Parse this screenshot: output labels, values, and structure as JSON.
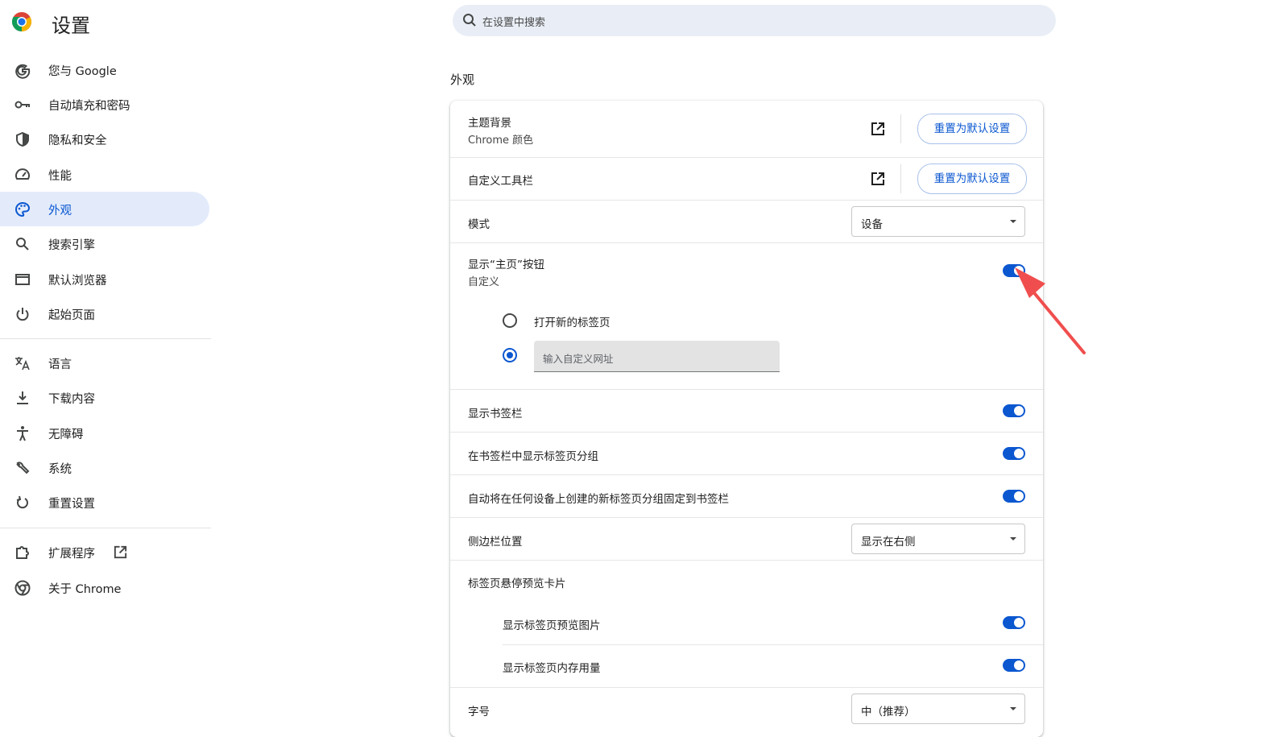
{
  "app": {
    "title": "设置"
  },
  "search": {
    "placeholder": "在设置中搜索"
  },
  "sidebar": {
    "items": [
      {
        "label": "您与 Google",
        "icon": "google-g-icon"
      },
      {
        "label": "自动填充和密码",
        "icon": "key-icon"
      },
      {
        "label": "隐私和安全",
        "icon": "shield-icon"
      },
      {
        "label": "性能",
        "icon": "speedometer-icon"
      },
      {
        "label": "外观",
        "icon": "palette-icon",
        "active": true
      },
      {
        "label": "搜索引擎",
        "icon": "search-icon"
      },
      {
        "label": "默认浏览器",
        "icon": "browser-window-icon"
      },
      {
        "label": "起始页面",
        "icon": "power-icon"
      },
      {
        "label": "语言",
        "icon": "translate-icon"
      },
      {
        "label": "下载内容",
        "icon": "download-icon"
      },
      {
        "label": "无障碍",
        "icon": "accessibility-icon"
      },
      {
        "label": "系统",
        "icon": "wrench-icon"
      },
      {
        "label": "重置设置",
        "icon": "reset-icon"
      },
      {
        "label": "扩展程序",
        "icon": "puzzle-icon"
      },
      {
        "label": "关于 Chrome",
        "icon": "chrome-icon"
      }
    ]
  },
  "appearance": {
    "section_title": "外观",
    "theme": {
      "title": "主题背景",
      "subtitle": "Chrome 颜色",
      "reset_label": "重置为默认设置"
    },
    "toolbar": {
      "title": "自定义工具栏",
      "reset_label": "重置为默认设置"
    },
    "mode": {
      "title": "模式",
      "value": "设备"
    },
    "home_button": {
      "title": "显示“主页”按钮",
      "subtitle": "自定义",
      "enabled": true,
      "option_new_tab": "打开新的标签页",
      "option_custom": "输入自定义网址",
      "selected": "custom"
    },
    "bookmarks_bar": {
      "title": "显示书签栏",
      "enabled": true
    },
    "tab_groups_in_bookmarks": {
      "title": "在书签栏中显示标签页分组",
      "enabled": true
    },
    "pin_tab_groups": {
      "title": "自动将在任何设备上创建的新标签页分组固定到书签栏",
      "enabled": true
    },
    "side_panel": {
      "title": "侧边栏位置",
      "value": "显示在右侧"
    },
    "hover_card": {
      "title": "标签页悬停预览卡片",
      "preview_images": {
        "title": "显示标签页预览图片",
        "enabled": true
      },
      "memory_usage": {
        "title": "显示标签页内存用量",
        "enabled": true
      }
    },
    "font_size": {
      "title": "字号",
      "value": "中（推荐）"
    }
  },
  "colors": {
    "accent": "#0b57d0",
    "active_nav_bg": "#e3ebfb",
    "annotation_arrow": "#f04e4e"
  }
}
